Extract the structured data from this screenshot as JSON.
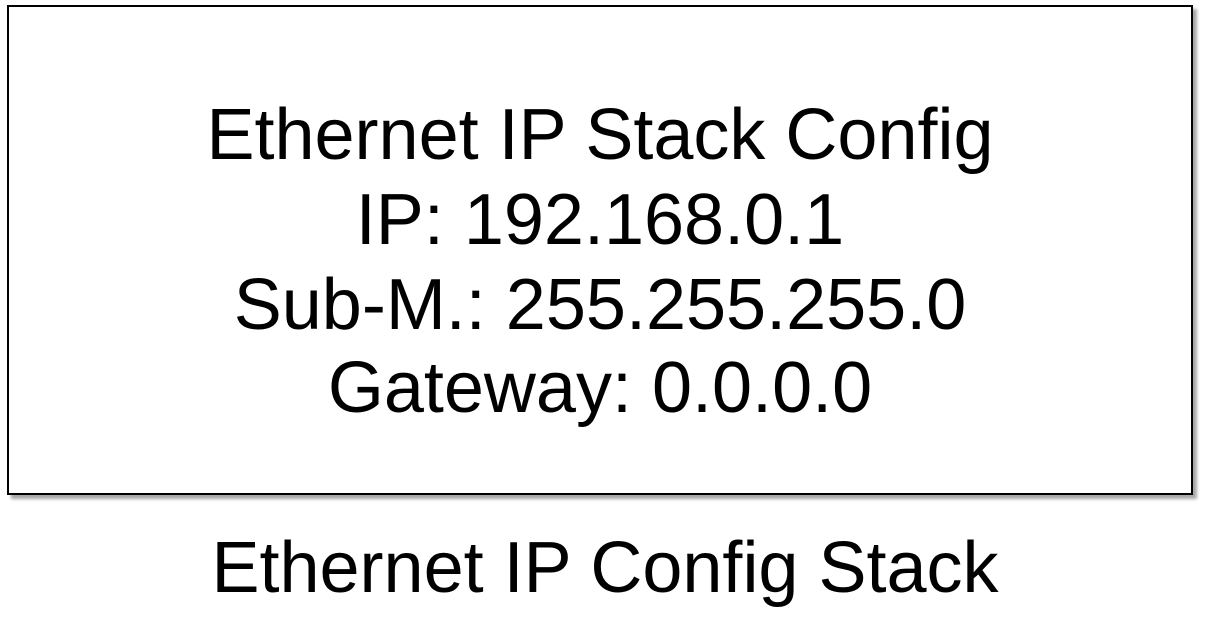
{
  "box": {
    "title": "Ethernet IP Stack Config",
    "ip_line": "IP: 192.168.0.1",
    "subnet_line": "Sub-M.: 255.255.255.0",
    "gateway_line": "Gateway: 0.0.0.0"
  },
  "caption": "Ethernet IP Config Stack"
}
